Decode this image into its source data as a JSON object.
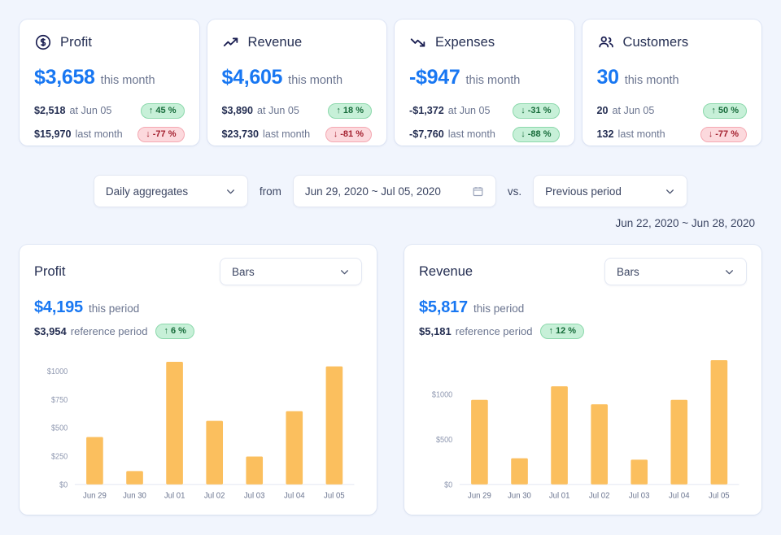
{
  "kpis": [
    {
      "icon": "dollar-circle-icon",
      "title": "Profit",
      "value": "$3,658",
      "value_label": "this month",
      "rows": [
        {
          "amount": "$2,518",
          "label": "at Jun 05",
          "badge": "↑ 45 %",
          "dir": "up"
        },
        {
          "amount": "$15,970",
          "label": "last month",
          "badge": "↓ -77 %",
          "dir": "down"
        }
      ]
    },
    {
      "icon": "trending-up-icon",
      "title": "Revenue",
      "value": "$4,605",
      "value_label": "this month",
      "rows": [
        {
          "amount": "$3,890",
          "label": "at Jun 05",
          "badge": "↑ 18 %",
          "dir": "up"
        },
        {
          "amount": "$23,730",
          "label": "last month",
          "badge": "↓ -81 %",
          "dir": "down"
        }
      ]
    },
    {
      "icon": "trending-down-icon",
      "title": "Expenses",
      "value": "-$947",
      "value_label": "this month",
      "rows": [
        {
          "amount": "-$1,372",
          "label": "at Jun 05",
          "badge": "↓ -31 %",
          "dir": "up"
        },
        {
          "amount": "-$7,760",
          "label": "last month",
          "badge": "↓ -88 %",
          "dir": "up"
        }
      ]
    },
    {
      "icon": "users-icon",
      "title": "Customers",
      "value": "30",
      "value_label": "this month",
      "rows": [
        {
          "amount": "20",
          "label": "at Jun 05",
          "badge": "↑ 50 %",
          "dir": "up"
        },
        {
          "amount": "132",
          "label": "last month",
          "badge": "↓ -77 %",
          "dir": "down"
        }
      ]
    }
  ],
  "filters": {
    "aggregate": "Daily aggregates",
    "from_label": "from",
    "date_range": "Jun 29, 2020 ~ Jul 05, 2020",
    "vs_label": "vs.",
    "comparison": "Previous period",
    "reference_range": "Jun 22, 2020 ~ Jun 28, 2020"
  },
  "charts": [
    {
      "title": "Profit",
      "chart_type_select": "Bars",
      "value": "$4,195",
      "value_label": "this period",
      "reference_amount": "$3,954",
      "reference_label": "reference period",
      "badge": "↑ 6 %",
      "badge_dir": "up"
    },
    {
      "title": "Revenue",
      "chart_type_select": "Bars",
      "value": "$5,817",
      "value_label": "this period",
      "reference_amount": "$5,181",
      "reference_label": "reference period",
      "badge": "↑ 12 %",
      "badge_dir": "up"
    }
  ],
  "colors": {
    "bar": "#fbbf5e",
    "accent": "#1877f2",
    "page_bg": "#f1f5fd",
    "positive": "#176b3a",
    "negative": "#a42130"
  },
  "chart_data": [
    {
      "type": "bar",
      "title": "Profit",
      "xlabel": "",
      "ylabel": "",
      "categories": [
        "Jun 29",
        "Jun 30",
        "Jul 01",
        "Jul 02",
        "Jul 03",
        "Jul 04",
        "Jul 05"
      ],
      "values": [
        417,
        117,
        1080,
        560,
        245,
        645,
        1040
      ],
      "ylim": [
        0,
        1150
      ],
      "yticks": [
        0,
        250,
        500,
        750,
        1000
      ],
      "ytick_labels": [
        "$0",
        "$250",
        "$500",
        "$750",
        "$1000"
      ],
      "grid": false,
      "legend": false
    },
    {
      "type": "bar",
      "title": "Revenue",
      "xlabel": "",
      "ylabel": "",
      "categories": [
        "Jun 29",
        "Jun 30",
        "Jul 01",
        "Jul 02",
        "Jul 03",
        "Jul 04",
        "Jul 05"
      ],
      "values": [
        940,
        290,
        1090,
        890,
        275,
        940,
        1380
      ],
      "ylim": [
        0,
        1450
      ],
      "yticks": [
        0,
        500,
        1000
      ],
      "ytick_labels": [
        "$0",
        "$500",
        "$1000"
      ],
      "grid": false,
      "legend": false
    }
  ]
}
